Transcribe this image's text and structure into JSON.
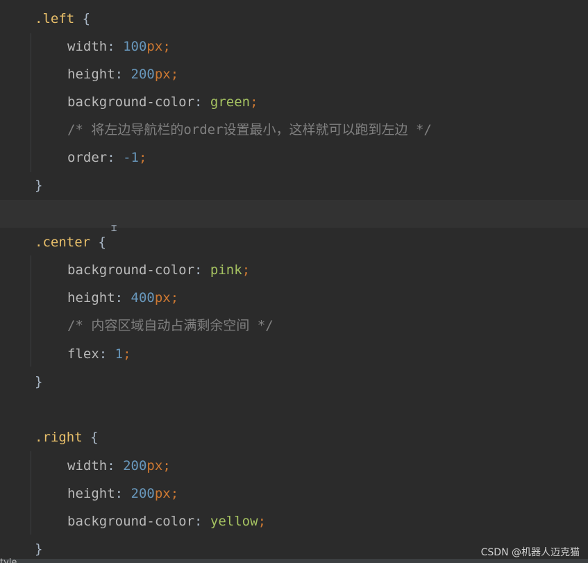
{
  "code": {
    "left_block": {
      "selector": ".left",
      "open": " {",
      "lines": [
        {
          "prop": "width",
          "num": "100",
          "unit": "px"
        },
        {
          "prop": "height",
          "num": "200",
          "unit": "px"
        },
        {
          "prop": "background-color",
          "kw": "green"
        },
        {
          "comment": "/* 将左边导航栏的order设置最小，这样就可以跑到左边 */"
        },
        {
          "prop": "order",
          "num": "-1"
        }
      ],
      "close": "}"
    },
    "center_block": {
      "selector": ".center",
      "open": " {",
      "lines": [
        {
          "prop": "background-color",
          "kw": "pink"
        },
        {
          "prop": "height",
          "num": "400",
          "unit": "px"
        },
        {
          "comment": "/* 内容区域自动占满剩余空间 */"
        },
        {
          "prop": "flex",
          "num": "1"
        }
      ],
      "close": "}"
    },
    "right_block": {
      "selector": ".right",
      "open": " {",
      "lines": [
        {
          "prop": "width",
          "num": "200",
          "unit": "px"
        },
        {
          "prop": "height",
          "num": "200",
          "unit": "px"
        },
        {
          "prop": "background-color",
          "kw": "yellow"
        }
      ],
      "close": "}"
    }
  },
  "status": {
    "left_text": "tyle"
  },
  "watermark": "CSDN @机器人迈克猫",
  "colors": {
    "background": "#2b2b2b",
    "selector": "#e8bf6a",
    "property": "#bababa",
    "number": "#6897bb",
    "keyword_value": "#a5c261",
    "punctuation": "#cc7832",
    "comment": "#808080"
  }
}
